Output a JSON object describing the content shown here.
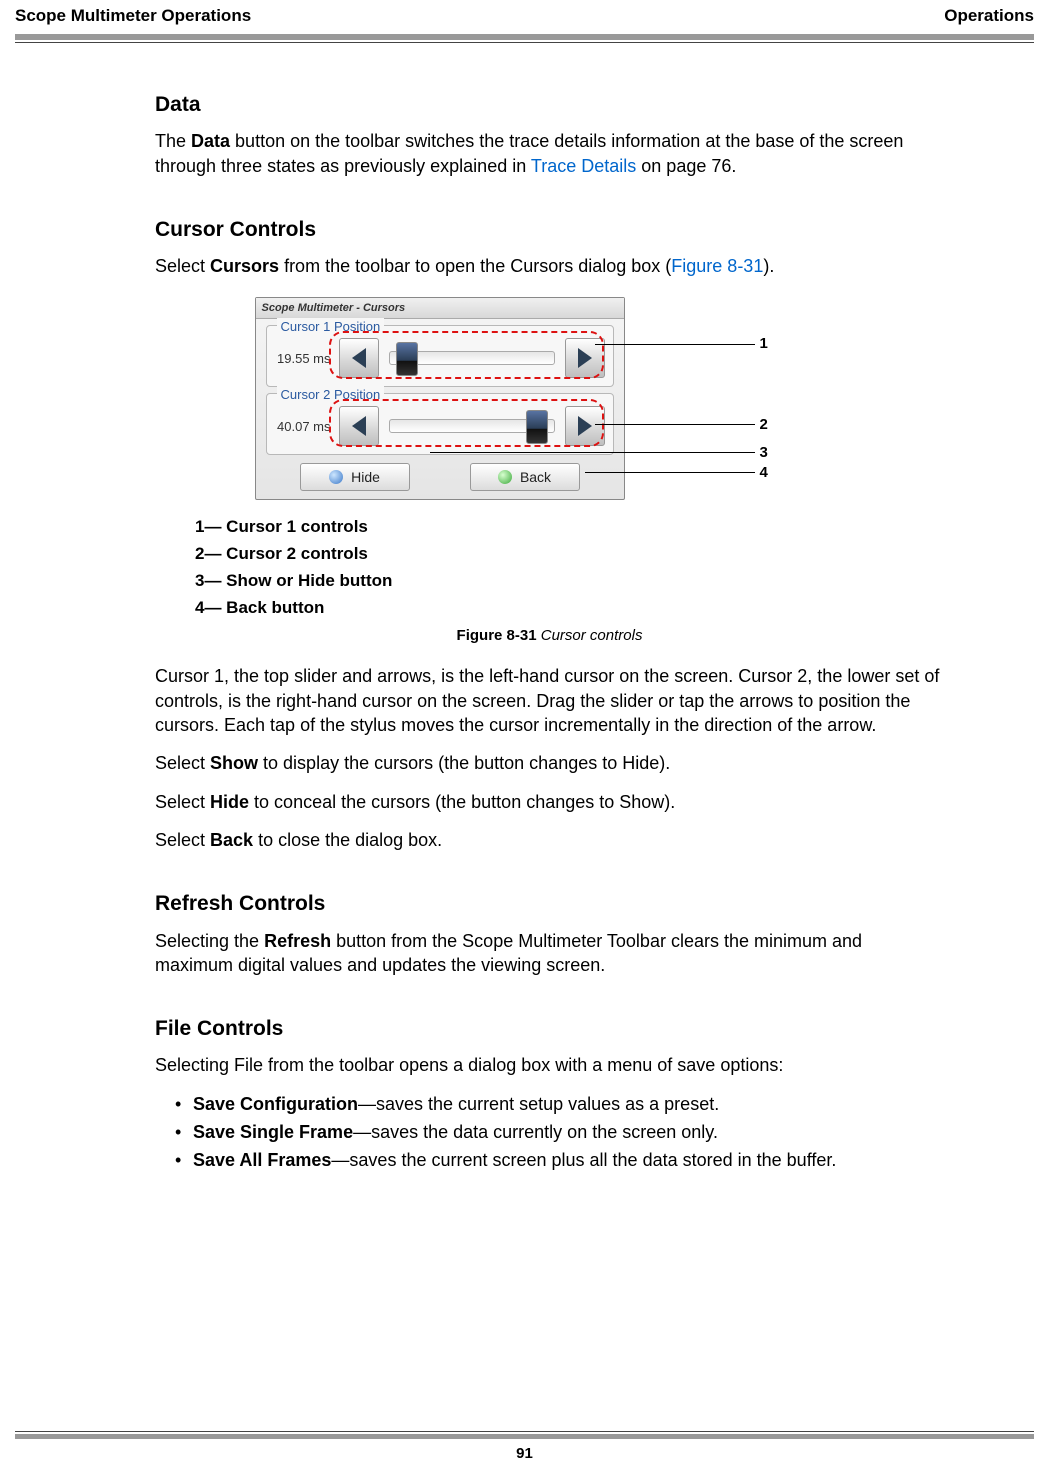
{
  "header": {
    "left": "Scope Multimeter Operations",
    "right": "Operations"
  },
  "data_section": {
    "heading": "Data",
    "para_prefix": "The ",
    "para_bold1": "Data",
    "para_mid": " button on the toolbar switches the trace details information at the base of the screen through three states as previously explained in ",
    "para_link": "Trace Details",
    "para_suffix": " on page 76."
  },
  "cursor_section": {
    "heading": "Cursor Controls",
    "intro_prefix": "Select ",
    "intro_bold": "Cursors",
    "intro_mid": " from the toolbar to open the Cursors dialog box (",
    "intro_link": "Figure 8-31",
    "intro_suffix": ").",
    "dialog_title": "Scope Multimeter - Cursors",
    "group1_legend": "Cursor 1 Position",
    "group1_value": "19.55 ms",
    "group2_legend": "Cursor 2 Position",
    "group2_value": "40.07 ms",
    "hide_label": "Hide",
    "back_label": "Back",
    "callouts": {
      "c1": "1",
      "c2": "2",
      "c3": "3",
      "c4": "4"
    },
    "legend": {
      "l1": "1— Cursor 1 controls",
      "l2": "2— Cursor 2 controls",
      "l3": "3— Show or Hide button",
      "l4": "4— Back button"
    },
    "figure_num": "Figure 8-31",
    "figure_title": " Cursor controls",
    "p_cursor_desc": "Cursor 1, the top slider and arrows, is the left-hand cursor on the screen. Cursor 2, the lower set of controls, is the right-hand cursor on the screen. Drag the slider or tap the arrows to position the cursors. Each tap of the stylus moves the cursor incrementally in the direction of the arrow.",
    "p_show_prefix": "Select ",
    "p_show_bold": "Show",
    "p_show_suffix": " to display the cursors (the button changes to Hide).",
    "p_hide_prefix": "Select ",
    "p_hide_bold": "Hide",
    "p_hide_suffix": " to conceal the cursors (the button changes to Show).",
    "p_back_prefix": "Select ",
    "p_back_bold": "Back",
    "p_back_suffix": " to close the dialog box."
  },
  "refresh_section": {
    "heading": "Refresh Controls",
    "p_prefix": "Selecting the ",
    "p_bold": "Refresh",
    "p_suffix": " button from the Scope Multimeter Toolbar clears the minimum and maximum digital values and updates the viewing screen."
  },
  "file_section": {
    "heading": "File Controls",
    "intro": "Selecting File from the toolbar opens a dialog box with a menu of save options:",
    "items": {
      "i1_bold": "Save Configuration",
      "i1_rest": "—saves the current setup values as a preset.",
      "i2_bold": "Save Single Frame",
      "i2_rest": "—saves the data currently on the screen only.",
      "i3_bold": "Save All Frames",
      "i3_rest": "—saves the current screen plus all the data stored in the buffer."
    }
  },
  "page_number": "91"
}
